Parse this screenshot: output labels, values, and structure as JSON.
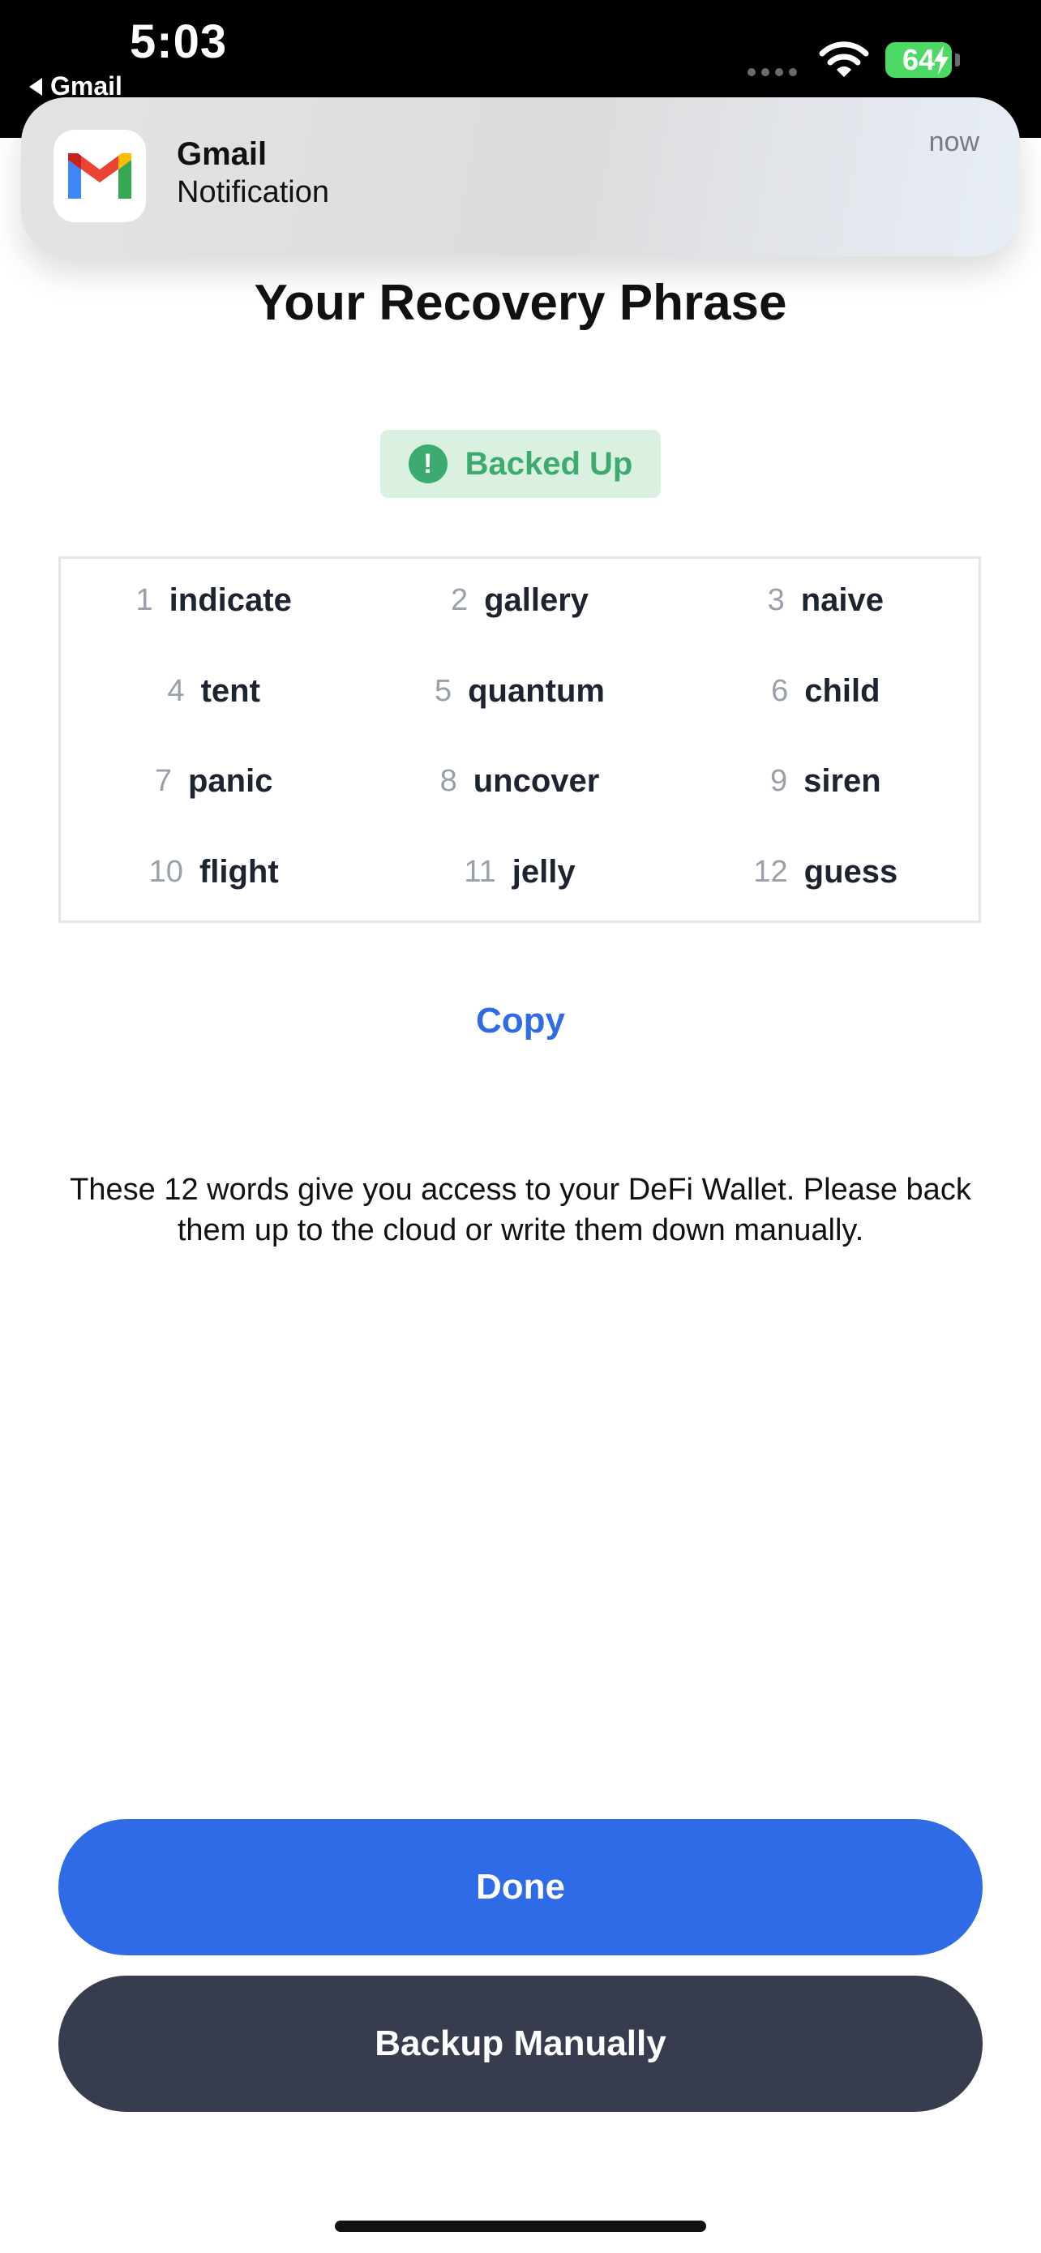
{
  "status_bar": {
    "time": "5:03",
    "back_app": "Gmail",
    "battery": "64"
  },
  "notification": {
    "app": "Gmail",
    "body": "Notification",
    "time": "now",
    "icon": "gmail-logo-icon"
  },
  "page": {
    "title": "Your Recovery Phrase",
    "badge": {
      "label": "Backed Up",
      "icon": "exclamation-circle-icon",
      "color": "#3daa6f",
      "background": "#daf1e2"
    },
    "words": [
      {
        "num": "1",
        "word": "indicate"
      },
      {
        "num": "2",
        "word": "gallery"
      },
      {
        "num": "3",
        "word": "naive"
      },
      {
        "num": "4",
        "word": "tent"
      },
      {
        "num": "5",
        "word": "quantum"
      },
      {
        "num": "6",
        "word": "child"
      },
      {
        "num": "7",
        "word": "panic"
      },
      {
        "num": "8",
        "word": "uncover"
      },
      {
        "num": "9",
        "word": "siren"
      },
      {
        "num": "10",
        "word": "flight"
      },
      {
        "num": "11",
        "word": "jelly"
      },
      {
        "num": "12",
        "word": "guess"
      }
    ],
    "copy_label": "Copy",
    "description": "These 12 words give you access to your DeFi Wallet. Please back them up to the cloud or write them down manually."
  },
  "buttons": {
    "done": "Done",
    "backup_manually": "Backup Manually"
  },
  "colors": {
    "primary": "#2f6be6",
    "secondary_button": "#373d4e",
    "text": "#111111"
  }
}
